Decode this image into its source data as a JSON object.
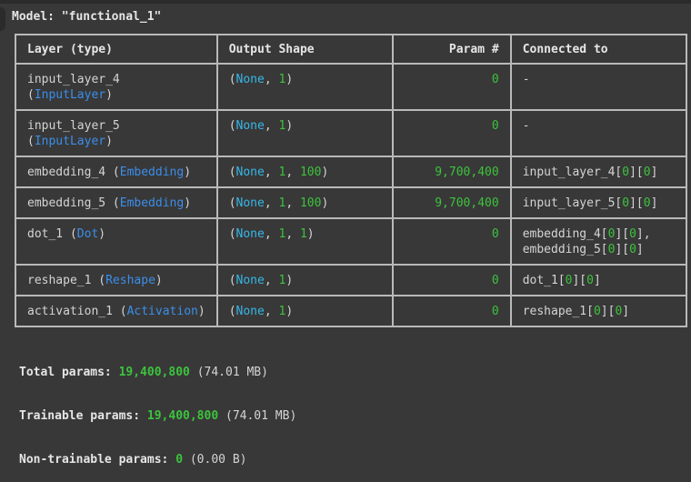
{
  "model_title": "Model: \"functional_1\"",
  "headers": {
    "layer": "Layer (type)",
    "output": "Output Shape",
    "params": "Param #",
    "connected": "Connected to"
  },
  "rows": [
    {
      "name": "input_layer_4",
      "type": "InputLayer",
      "shape": [
        "None",
        "1"
      ],
      "params": "0",
      "connected": [
        "-"
      ]
    },
    {
      "name": "input_layer_5",
      "type": "InputLayer",
      "shape": [
        "None",
        "1"
      ],
      "params": "0",
      "connected": [
        "-"
      ]
    },
    {
      "name": "embedding_4",
      "type": "Embedding",
      "shape": [
        "None",
        "1",
        "100"
      ],
      "params": "9,700,400",
      "connected": [
        "input_layer_4[0][0]"
      ]
    },
    {
      "name": "embedding_5",
      "type": "Embedding",
      "shape": [
        "None",
        "1",
        "100"
      ],
      "params": "9,700,400",
      "connected": [
        "input_layer_5[0][0]"
      ]
    },
    {
      "name": "dot_1",
      "type": "Dot",
      "shape": [
        "None",
        "1",
        "1"
      ],
      "params": "0",
      "connected": [
        "embedding_4[0][0],",
        "embedding_5[0][0]"
      ]
    },
    {
      "name": "reshape_1",
      "type": "Reshape",
      "shape": [
        "None",
        "1"
      ],
      "params": "0",
      "connected": [
        "dot_1[0][0]"
      ]
    },
    {
      "name": "activation_1",
      "type": "Activation",
      "shape": [
        "None",
        "1"
      ],
      "params": "0",
      "connected": [
        "reshape_1[0][0]"
      ]
    }
  ],
  "summary": {
    "total_label": "Total params:",
    "total_value": "19,400,800",
    "total_size": "(74.01 MB)",
    "trainable_label": "Trainable params:",
    "trainable_value": "19,400,800",
    "trainable_size": "(74.01 MB)",
    "nontrainable_label": "Non-trainable params:",
    "nontrainable_value": "0",
    "nontrainable_size": "(0.00 B)"
  },
  "colors": {
    "background": "#383838",
    "cyan": "#36b7e8",
    "green": "#3cc33c",
    "blue": "#3b8eea",
    "border": "#b9b9b9"
  }
}
